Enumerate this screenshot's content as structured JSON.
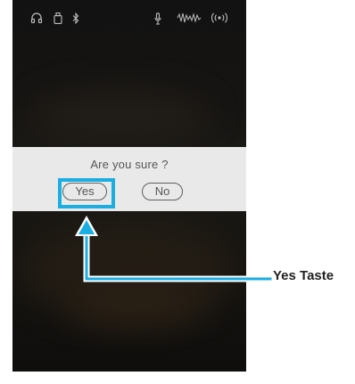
{
  "status_icons": [
    "headphones-icon",
    "usb-icon",
    "bluetooth-icon",
    "microphone-icon",
    "audio-wave-icon",
    "wireless-icon"
  ],
  "dialog": {
    "title": "Are you sure ?",
    "yes_label": "Yes",
    "no_label": "No"
  },
  "annotation": {
    "label": "Yes Taste"
  },
  "colors": {
    "highlight": "#1aaee3",
    "dialog_bg": "#e9e9e9",
    "screen_bg": "#141414"
  }
}
